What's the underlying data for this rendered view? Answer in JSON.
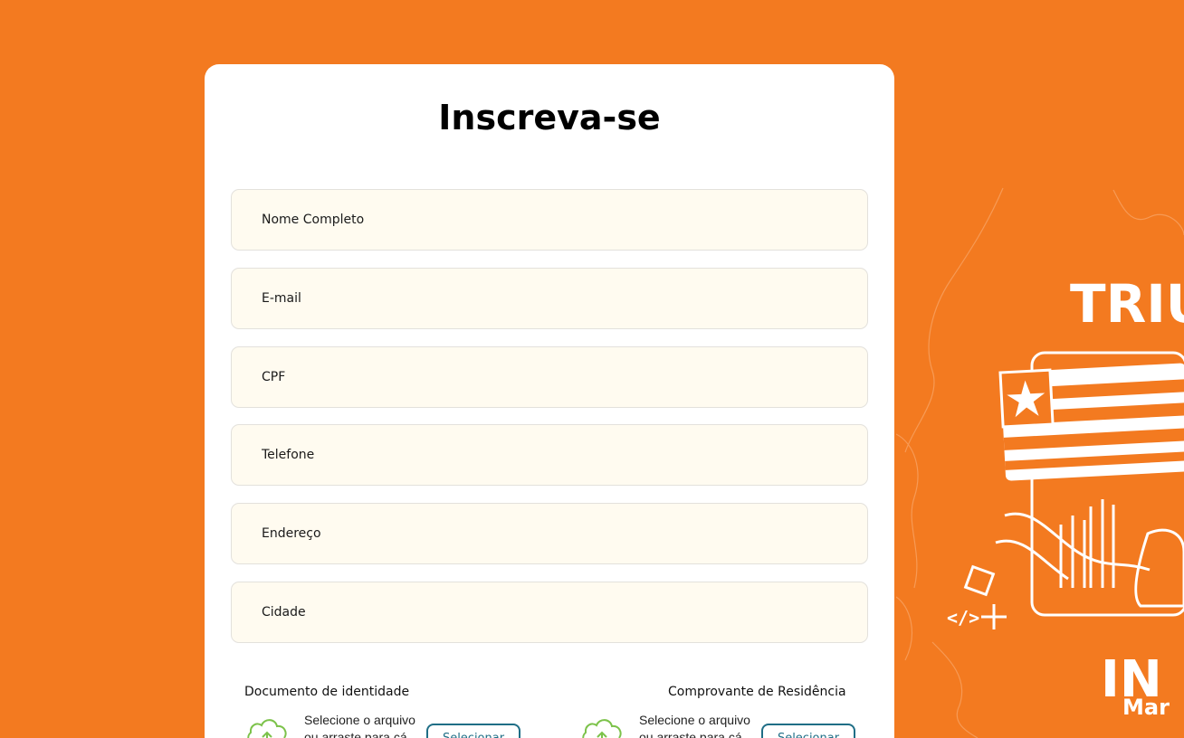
{
  "form": {
    "title": "Inscreva-se",
    "fields": [
      {
        "placeholder": "Nome Completo"
      },
      {
        "placeholder": "E-mail"
      },
      {
        "placeholder": "CPF"
      },
      {
        "placeholder": "Telefone"
      },
      {
        "placeholder": "Endereço"
      },
      {
        "placeholder": "Cidade"
      }
    ],
    "uploads": [
      {
        "label": "Documento de identidade",
        "hint_line1": "Selecione o arquivo",
        "hint_line2": "ou arraste para cá",
        "button": "Selecionar"
      },
      {
        "label": "Comprovante de Residência",
        "hint_line1": "Selecione o arquivo",
        "hint_line2": "ou arraste para cá",
        "button": "Selecionar"
      }
    ]
  },
  "branding": {
    "text_top": "TRIU",
    "text_bottom": "IN",
    "text_bottom_small": "Mar"
  },
  "colors": {
    "background": "#F37A20",
    "card": "#FFFFFF",
    "field_bg": "#FFFBF0",
    "accent": "#1F6E86",
    "upload_icon": "#7CC24A"
  }
}
